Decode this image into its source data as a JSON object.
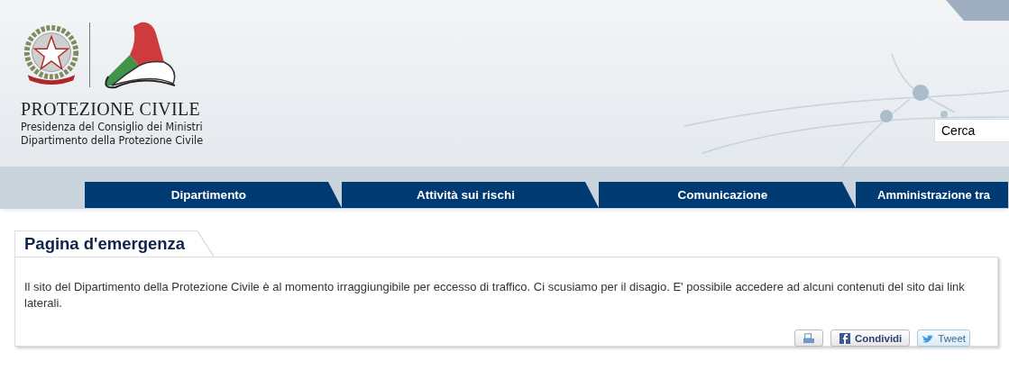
{
  "header": {
    "brand": "PROTEZIONE CIVILE",
    "subtitle_lines": [
      "Presidenza del Consiglio dei Ministri",
      "Dipartimento della Protezione Civile"
    ],
    "search": {
      "value": "Cerca"
    }
  },
  "nav": {
    "tabs": [
      {
        "label": "Dipartimento"
      },
      {
        "label": "Attività sui rischi"
      },
      {
        "label": "Comunicazione"
      },
      {
        "label": "Amministrazione tra"
      }
    ]
  },
  "panel": {
    "title": "Pagina d'emergenza",
    "body": "Il sito del Dipartimento della Protezione Civile è al momento irraggiungibile per eccesso di traffico. Ci scusiamo per il disagio. E' possibile accedere ad alcuni contenuti del sito dai link laterali.",
    "actions": [
      {
        "kind": "print"
      },
      {
        "kind": "facebook",
        "label": "Condividi"
      },
      {
        "kind": "twitter",
        "label": "Tweet"
      }
    ]
  }
}
